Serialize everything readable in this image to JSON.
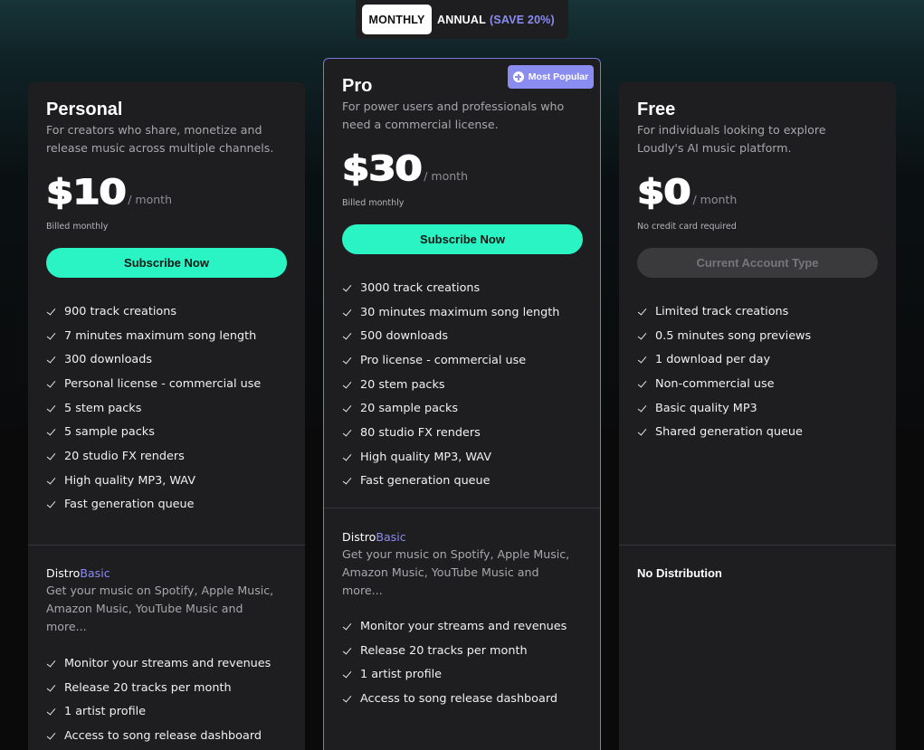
{
  "billing_toggle": {
    "monthly": "MONTHLY",
    "annual": "ANNUAL",
    "save": "(SAVE 20%)"
  },
  "plans": {
    "personal": {
      "name": "Personal",
      "description": "For creators who share, monetize and release music across multiple channels.",
      "price": "$10",
      "period": "/ month",
      "billing_note": "Billed monthly",
      "cta": "Subscribe Now",
      "features": [
        "900 track creations",
        "7 minutes maximum song length",
        "300 downloads",
        "Personal license - commercial use",
        "5 stem packs",
        "5 sample packs",
        "20 studio FX renders",
        "High quality MP3, WAV",
        "Fast generation queue"
      ],
      "distro": {
        "prefix": "Distro",
        "tier": "Basic",
        "description": "Get your music on Spotify, Apple Music, Amazon Music, YouTube Music and more...",
        "features": [
          "Monitor your streams and revenues",
          "Release 20 tracks per month",
          "1 artist profile",
          "Access to song release dashboard"
        ]
      }
    },
    "pro": {
      "name": "Pro",
      "badge": "Most Popular",
      "description": "For power users and professionals who need a commercial license.",
      "price": "$30",
      "period": "/ month",
      "billing_note": "Billed monthly",
      "cta": "Subscribe Now",
      "features": [
        "3000 track creations",
        "30 minutes maximum song length",
        "500 downloads",
        "Pro license - commercial use",
        "20 stem packs",
        "20 sample packs",
        "80 studio FX renders",
        "High quality MP3, WAV",
        "Fast generation queue"
      ],
      "distro": {
        "prefix": "Distro",
        "tier": "Basic",
        "description": "Get your music on Spotify, Apple Music, Amazon Music, YouTube Music and more...",
        "features": [
          "Monitor your streams and revenues",
          "Release 20 tracks per month",
          "1 artist profile",
          "Access to song release dashboard"
        ]
      }
    },
    "free": {
      "name": "Free",
      "description": "For individuals looking to explore Loudly's AI music platform.",
      "price": "$0",
      "period": "/ month",
      "billing_note": "No credit card required",
      "cta": "Current Account Type",
      "features": [
        "Limited track creations",
        "0.5 minutes song previews",
        "1 download per day",
        "Non-commercial use",
        "Basic quality MP3",
        "Shared generation queue"
      ],
      "distro_none": "No Distribution"
    }
  },
  "colors": {
    "accent_teal": "#2af4c4",
    "accent_purple": "#8a8cf0",
    "card_bg": "#1e1e20"
  }
}
